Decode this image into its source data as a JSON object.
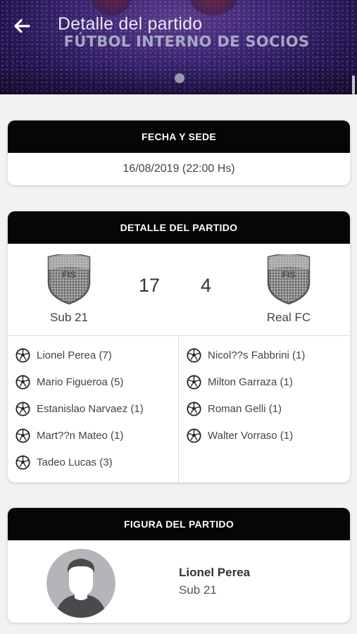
{
  "header": {
    "title": "Detalle del partido",
    "banner_text": "FÚTBOL INTERNO DE SOCIOS",
    "back_icon": "arrow-left-icon",
    "colors": {
      "banner_bg": "#2a1a5a",
      "title": "#e8e6f0"
    }
  },
  "fecha_card": {
    "heading": "FECHA Y SEDE",
    "value": "16/08/2019 (22:00 Hs)"
  },
  "detalle_card": {
    "heading": "DETALLE DEL PARTIDO",
    "home": {
      "name": "Sub 21",
      "score": "17",
      "crest_label": "FIS"
    },
    "away": {
      "name": "Real FC",
      "score": "4",
      "crest_label": "FIS"
    },
    "home_scorers": [
      "Lionel Perea (7)",
      "Mario Figueroa (5)",
      "Estanislao Narvaez (1)",
      "Mart??n Mateo (1)",
      "Tadeo Lucas (3)"
    ],
    "away_scorers": [
      "Nicol??s Fabbrini (1)",
      "Milton Garraza (1)",
      "Roman Gelli (1)",
      "Walter Vorraso (1)"
    ],
    "ball_icon": "soccer-ball-icon"
  },
  "figura_card": {
    "heading": "FIGURA DEL PARTIDO",
    "player_name": "Lionel Perea",
    "player_team": "Sub 21",
    "avatar_icon": "avatar-placeholder-icon"
  }
}
